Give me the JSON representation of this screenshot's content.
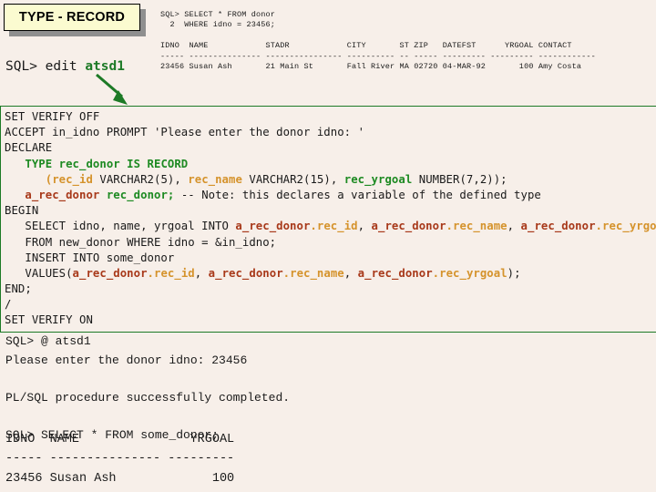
{
  "title": {
    "label": "TYPE - RECORD",
    "box_fill": "#fbfbd0",
    "shadow_color": "#8f8f8f"
  },
  "colors": {
    "background": "#f7efe9",
    "keyword_green": "#1d8a22",
    "field_orange": "#d5932c",
    "variable_red": "#a8391a",
    "border_green": "#1d7a26",
    "text": "#1a1a1a"
  },
  "top_sql_output": {
    "lines": [
      "SQL> SELECT * FROM donor",
      "  2  WHERE idno = 23456;",
      "",
      "IDNO  NAME            STADR            CITY       ST ZIP   DATEFST      YRGOAL CONTACT",
      "----- --------------- ---------------- ---------- -- ----- --------- --------- ------------",
      "23456 Susan Ash       21 Main St       Fall River MA 02720 04-MAR-92       100 Amy Costa"
    ],
    "columns": [
      "IDNO",
      "NAME",
      "STADR",
      "CITY",
      "ST",
      "ZIP",
      "DATEFST",
      "YRGOAL",
      "CONTACT"
    ],
    "row": [
      "23456",
      "Susan Ash",
      "21 Main St",
      "Fall River",
      "MA",
      "02720",
      "04-MAR-92",
      "100",
      "Amy Costa"
    ]
  },
  "edit_prompt": {
    "prefix": "SQL> edit ",
    "filename": "atsd1"
  },
  "code": {
    "lines": [
      [
        {
          "t": "SET VERIFY OFF"
        }
      ],
      [
        {
          "t": "ACCEPT in_idno PROMPT 'Please enter the donor idno: '"
        }
      ],
      [
        {
          "t": "DECLARE"
        }
      ],
      [
        {
          "t": "   "
        },
        {
          "t": "TYPE rec_donor IS RECORD",
          "c": "kw-green"
        }
      ],
      [
        {
          "t": "      "
        },
        {
          "t": "(rec_id",
          "c": "kw-orange"
        },
        {
          "t": " VARCHAR2(5), "
        },
        {
          "t": "rec_name",
          "c": "kw-orange"
        },
        {
          "t": " VARCHAR2(15), "
        },
        {
          "t": "rec_yrgoal",
          "c": "kw-green"
        },
        {
          "t": " NUMBER(7,2));"
        }
      ],
      [
        {
          "t": "   "
        },
        {
          "t": "a_rec_donor",
          "c": "kw-red"
        },
        {
          "t": " "
        },
        {
          "t": "rec_donor;",
          "c": "kw-green"
        },
        {
          "t": " -- Note: this declares a variable of the defined type"
        }
      ],
      [
        {
          "t": "BEGIN"
        }
      ],
      [
        {
          "t": "   SELECT idno, name, yrgoal INTO "
        },
        {
          "t": "a_rec_donor",
          "c": "kw-red"
        },
        {
          "t": ".rec_id",
          "c": "kw-orange"
        },
        {
          "t": ", "
        },
        {
          "t": "a_rec_donor",
          "c": "kw-red"
        },
        {
          "t": ".rec_name",
          "c": "kw-orange"
        },
        {
          "t": ", "
        },
        {
          "t": "a_rec_donor",
          "c": "kw-red"
        },
        {
          "t": ".rec_yrgoal",
          "c": "kw-orange"
        }
      ],
      [
        {
          "t": "   FROM new_donor WHERE idno = &in_idno;"
        }
      ],
      [
        {
          "t": "   INSERT INTO some_donor"
        }
      ],
      [
        {
          "t": "   VALUES("
        },
        {
          "t": "a_rec_donor",
          "c": "kw-red"
        },
        {
          "t": ".rec_id",
          "c": "kw-orange"
        },
        {
          "t": ", "
        },
        {
          "t": "a_rec_donor",
          "c": "kw-red"
        },
        {
          "t": ".rec_name",
          "c": "kw-orange"
        },
        {
          "t": ", "
        },
        {
          "t": "a_rec_donor",
          "c": "kw-red"
        },
        {
          "t": ".rec_yrgoal",
          "c": "kw-orange"
        },
        {
          "t": ");"
        }
      ],
      [
        {
          "t": "END;"
        }
      ],
      [
        {
          "t": "/"
        }
      ],
      [
        {
          "t": "SET VERIFY ON"
        }
      ]
    ]
  },
  "bottom_output": {
    "lines": [
      "SQL> @ atsd1",
      "Please enter the donor idno: 23456",
      "",
      "PL/SQL procedure successfully completed.",
      "",
      "SQL> SELECT * FROM some_donor;"
    ]
  },
  "result_table": {
    "lines": [
      "IDNO  NAME               YRGOAL",
      "----- --------------- ---------",
      "23456 Susan Ash             100"
    ],
    "columns": [
      "IDNO",
      "NAME",
      "YRGOAL"
    ],
    "row": [
      "23456",
      "Susan Ash",
      "100"
    ]
  }
}
